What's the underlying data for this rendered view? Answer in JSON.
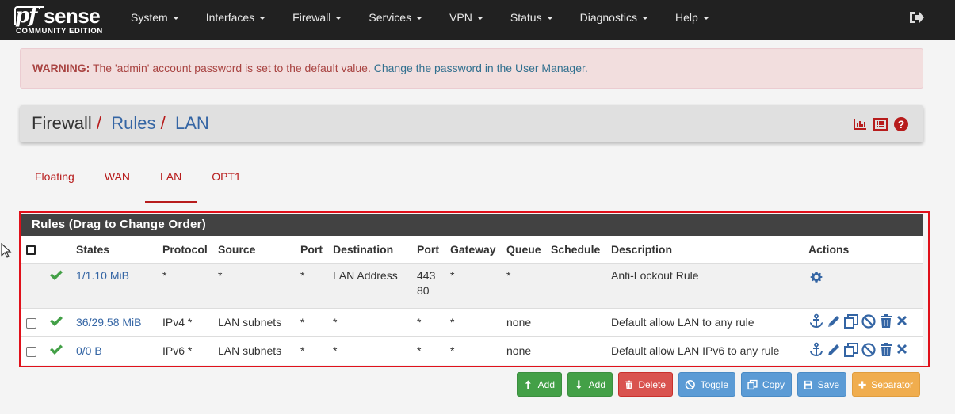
{
  "navbar": {
    "logo_pf": "pf",
    "logo_sense": "sense",
    "logo_edition": "COMMUNITY EDITION",
    "menu": [
      "System",
      "Interfaces",
      "Firewall",
      "Services",
      "VPN",
      "Status",
      "Diagnostics",
      "Help"
    ],
    "logout_icon": "sign-out-icon"
  },
  "alert": {
    "label": "WARNING:",
    "text": " The 'admin' account password is set to the default value. ",
    "link": "Change the password in the User Manager."
  },
  "breadcrumb": {
    "root": "Firewall",
    "sep": "/",
    "mid": "Rules",
    "leaf": "LAN",
    "icons": [
      "bar-chart-icon",
      "list-icon",
      "help-icon"
    ]
  },
  "tabs": [
    "Floating",
    "WAN",
    "LAN",
    "OPT1"
  ],
  "active_tab": "LAN",
  "panel": {
    "title": "Rules (Drag to Change Order)",
    "columns": [
      "",
      "",
      "States",
      "Protocol",
      "Source",
      "Port",
      "Destination",
      "Port",
      "Gateway",
      "Queue",
      "Schedule",
      "Description",
      "Actions"
    ],
    "rows": [
      {
        "states": "1/1.10 MiB",
        "protocol": "*",
        "source": "*",
        "src_port": "*",
        "destination": "LAN Address",
        "dst_port_1": "443",
        "dst_port_2": "80",
        "gateway": "*",
        "queue": "*",
        "schedule": "",
        "description": "Anti-Lockout Rule"
      },
      {
        "states": "36/29.58 MiB",
        "protocol": "IPv4 *",
        "source": "LAN subnets",
        "src_port": "*",
        "destination": "*",
        "dst_port": "*",
        "gateway": "*",
        "queue": "none",
        "schedule": "",
        "description": "Default allow LAN to any rule"
      },
      {
        "states": "0/0 B",
        "protocol": "IPv6 *",
        "source": "LAN subnets",
        "src_port": "*",
        "destination": "*",
        "dst_port": "*",
        "gateway": "*",
        "queue": "none",
        "schedule": "",
        "description": "Default allow LAN IPv6 to any rule"
      }
    ]
  },
  "buttons": {
    "add_top": "Add",
    "add_bottom": "Add",
    "delete": "Delete",
    "toggle": "Toggle",
    "copy": "Copy",
    "save": "Save",
    "separator": "Separator"
  },
  "colors": {
    "navbar": "#212121",
    "accent_red": "#b71c1c",
    "link_blue": "#3465a4",
    "success_green": "#43a047"
  }
}
